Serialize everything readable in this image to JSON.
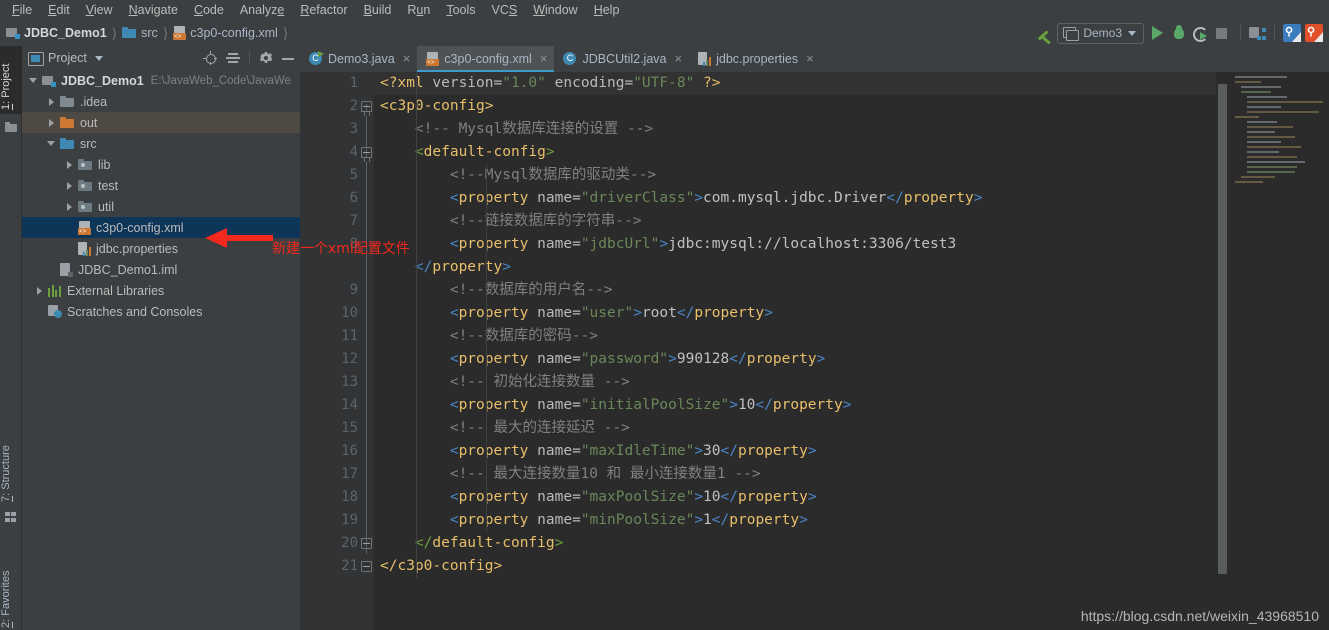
{
  "menubar": {
    "items": [
      "File",
      "Edit",
      "View",
      "Navigate",
      "Code",
      "Analyze",
      "Refactor",
      "Build",
      "Run",
      "Tools",
      "VCS",
      "Window",
      "Help"
    ]
  },
  "breadcrumb": {
    "project": "JDBC_Demo1",
    "folder": "src",
    "file": "c3p0-config.xml"
  },
  "toolbar_right": {
    "run_config": "Demo3",
    "icons": [
      "update-project-icon",
      "run-icon",
      "debug-icon",
      "run-with-coverage-icon",
      "stop-icon",
      "project-structure-icon",
      "search-everywhere-icon",
      "settings-icon"
    ]
  },
  "left_strip": {
    "project_tab": "1: Project",
    "structure_tab": "7: Structure",
    "favorites_tab": "2: Favorites"
  },
  "project_panel": {
    "title": "Project",
    "header_icons": [
      "locate-icon",
      "collapse-all-icon",
      "gear-icon",
      "hide-icon"
    ],
    "tree": [
      {
        "label": "JDBC_Demo1",
        "path": "E:\\JavaWeb_Code\\JavaWe",
        "icon": "module-icon",
        "indent": 0,
        "arrow": "down",
        "bold": true,
        "state": "normal"
      },
      {
        "label": ".idea",
        "path": "",
        "icon": "folder-icon",
        "indent": 1,
        "arrow": "right",
        "bold": false,
        "state": "normal"
      },
      {
        "label": "out",
        "path": "",
        "icon": "folder-orange-icon",
        "indent": 1,
        "arrow": "right",
        "bold": false,
        "state": "highlight"
      },
      {
        "label": "src",
        "path": "",
        "icon": "folder-icon",
        "indent": 1,
        "arrow": "down",
        "bold": false,
        "state": "normal"
      },
      {
        "label": "lib",
        "path": "",
        "icon": "package-icon",
        "indent": 2,
        "arrow": "right",
        "bold": false,
        "state": "normal"
      },
      {
        "label": "test",
        "path": "",
        "icon": "package-icon",
        "indent": 2,
        "arrow": "right",
        "bold": false,
        "state": "normal"
      },
      {
        "label": "util",
        "path": "",
        "icon": "package-icon",
        "indent": 2,
        "arrow": "right",
        "bold": false,
        "state": "normal"
      },
      {
        "label": "c3p0-config.xml",
        "path": "",
        "icon": "xml-file-icon",
        "indent": 2,
        "arrow": "none",
        "bold": false,
        "state": "selected"
      },
      {
        "label": "jdbc.properties",
        "path": "",
        "icon": "properties-file-icon",
        "indent": 2,
        "arrow": "none",
        "bold": false,
        "state": "normal"
      },
      {
        "label": "JDBC_Demo1.iml",
        "path": "",
        "icon": "iml-file-icon",
        "indent": 1,
        "arrow": "none",
        "bold": false,
        "state": "normal"
      },
      {
        "label": "External Libraries",
        "path": "",
        "icon": "libraries-icon",
        "indent": 0,
        "arrow": "right",
        "bold": false,
        "state": "normal"
      },
      {
        "label": "Scratches and Consoles",
        "path": "",
        "icon": "scratches-icon",
        "indent": 0,
        "arrow": "none",
        "bold": false,
        "state": "normal"
      }
    ]
  },
  "editor": {
    "tabs": [
      {
        "label": "Demo3.java",
        "icon": "java-class-icon",
        "active": false
      },
      {
        "label": "c3p0-config.xml",
        "icon": "xml-file-icon",
        "active": true
      },
      {
        "label": "JDBCUtil2.java",
        "icon": "java-class-icon",
        "active": false
      },
      {
        "label": "jdbc.properties",
        "icon": "properties-file-icon",
        "active": false
      }
    ],
    "close_glyph": "×",
    "line_numbers": [
      "1",
      "2",
      "3",
      "4",
      "5",
      "6",
      "7",
      "8",
      "",
      "9",
      "10",
      "11",
      "12",
      "13",
      "14",
      "15",
      "16",
      "17",
      "18",
      "19",
      "20",
      "21"
    ],
    "code_lines": [
      "<?xml version=\"1.0\" encoding=\"UTF-8\" ?>",
      "<c3p0-config>",
      "    <!-- Mysql数据库连接的设置 -->",
      "    <default-config>",
      "        <!--Mysql数据库的驱动类-->",
      "        <property name=\"driverClass\">com.mysql.jdbc.Driver</property>",
      "        <!--链接数据库的字符串-->",
      "        <property name=\"jdbcUrl\">jdbc:mysql://localhost:3306/test3",
      "    </property>",
      "        <!--数据库的用户名-->",
      "        <property name=\"user\">root</property>",
      "        <!--数据库的密码-->",
      "        <property name=\"password\">990128</property>",
      "        <!-- 初始化连接数量 -->",
      "        <property name=\"initialPoolSize\">10</property>",
      "        <!-- 最大的连接延迟 -->",
      "        <property name=\"maxIdleTime\">30</property>",
      "        <!-- 最大连接数量10 和 最小连接数量1 -->",
      "        <property name=\"maxPoolSize\">10</property>",
      "        <property name=\"minPoolSize\">1</property>",
      "    </default-config>",
      "</c3p0-config>"
    ]
  },
  "annotation": {
    "text": "新建一个xml配置文件",
    "color": "#f2291c"
  },
  "watermark": {
    "text": "https://blog.csdn.net/weixin_43968510"
  },
  "colors": {
    "background": "#3c3f41",
    "editor_background": "#2b2b2b",
    "selection": "#0d3558",
    "accent": "#3d9bc9",
    "tag": "#e8bf6a",
    "value": "#6a8759",
    "comment": "#808080"
  }
}
